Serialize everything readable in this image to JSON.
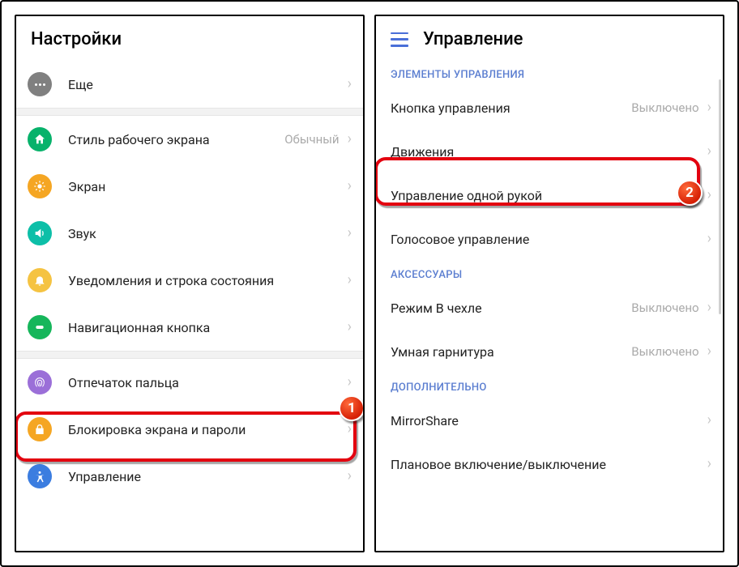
{
  "callouts": {
    "one": "1",
    "two": "2"
  },
  "left": {
    "title": "Настройки",
    "items": [
      {
        "icon": "more-icon",
        "icon_class": "ic-gray",
        "label": "Еще"
      },
      {
        "icon": "home-style-icon",
        "icon_class": "ic-green",
        "label": "Стиль рабочего экрана",
        "value": "Обычный"
      },
      {
        "icon": "display-icon",
        "icon_class": "ic-orange",
        "label": "Экран"
      },
      {
        "icon": "sound-icon",
        "icon_class": "ic-cyan",
        "label": "Звук"
      },
      {
        "icon": "notifications-icon",
        "icon_class": "ic-yellow",
        "label": "Уведомления и строка состояния"
      },
      {
        "icon": "navigation-icon",
        "icon_class": "ic-green2",
        "label": "Навигационная кнопка"
      },
      {
        "icon": "fingerprint-icon",
        "icon_class": "ic-purple",
        "label": "Отпечаток пальца"
      },
      {
        "icon": "lock-icon",
        "icon_class": "ic-orange2",
        "label": "Блокировка экрана и пароли"
      },
      {
        "icon": "accessibility-icon",
        "icon_class": "ic-blue",
        "label": "Управление"
      }
    ]
  },
  "right": {
    "title": "Управление",
    "sections": [
      {
        "label": "ЭЛЕМЕНТЫ УПРАВЛЕНИЯ",
        "items": [
          {
            "label": "Кнопка управления",
            "value": "Выключено"
          },
          {
            "label": "Движения"
          },
          {
            "label": "Управление одной рукой"
          },
          {
            "label": "Голосовое управление"
          }
        ]
      },
      {
        "label": "АКСЕССУАРЫ",
        "items": [
          {
            "label": "Режим В чехле",
            "value": "Выключено"
          },
          {
            "label": "Умная гарнитура",
            "value": "Выключено"
          }
        ]
      },
      {
        "label": "ДОПОЛНИТЕЛЬНО",
        "items": [
          {
            "label": "MirrorShare"
          },
          {
            "label": "Плановое включение/выключение"
          }
        ]
      }
    ]
  }
}
